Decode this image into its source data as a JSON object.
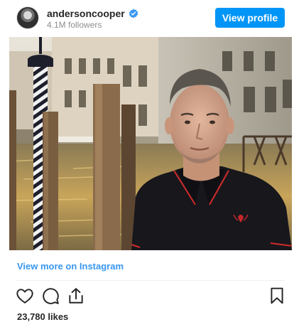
{
  "post": {
    "username": "andersoncooper",
    "followers": "4.1M followers",
    "view_profile_label": "View profile",
    "view_more_label": "View more on Instagram",
    "likes": "23,780 likes"
  },
  "icons": {
    "verified": "verified-badge-icon",
    "like": "heart-icon",
    "comment": "comment-icon",
    "share": "share-icon",
    "save": "bookmark-icon"
  },
  "colors": {
    "accent": "#0095f6",
    "link": "#3897f0",
    "verified": "#3897f0",
    "muted": "#8e8e8e"
  }
}
